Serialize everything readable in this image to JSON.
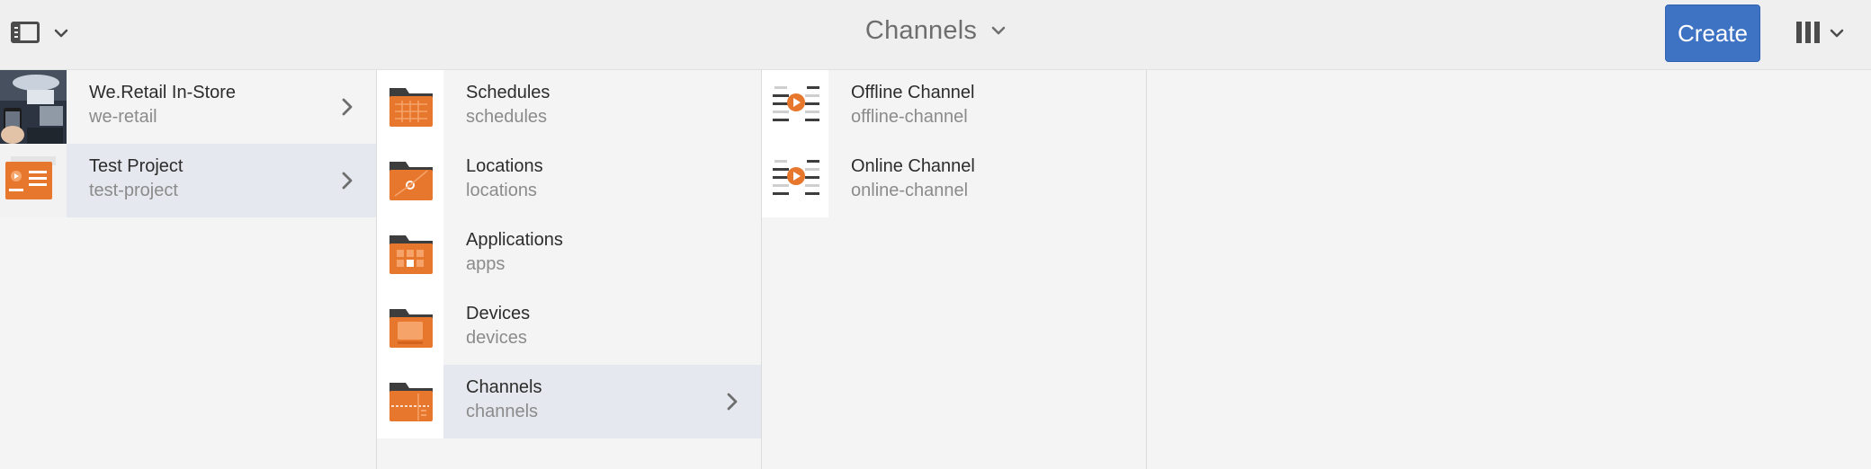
{
  "header": {
    "title": "Channels",
    "create_label": "Create",
    "rail_icon": "side-panel-icon",
    "view_icon": "column-view-icon"
  },
  "columns": [
    {
      "items": [
        {
          "title": "We.Retail In-Store",
          "subtitle": "we-retail",
          "thumb": "we-retail-photo",
          "has_children": true,
          "selected": false
        },
        {
          "title": "Test Project",
          "subtitle": "test-project",
          "thumb": "project-thumbnail",
          "has_children": true,
          "selected": true
        }
      ]
    },
    {
      "items": [
        {
          "title": "Schedules",
          "subtitle": "schedules",
          "thumb": "folder-schedules-icon",
          "has_children": false,
          "selected": false
        },
        {
          "title": "Locations",
          "subtitle": "locations",
          "thumb": "folder-locations-icon",
          "has_children": false,
          "selected": false
        },
        {
          "title": "Applications",
          "subtitle": "apps",
          "thumb": "folder-apps-icon",
          "has_children": false,
          "selected": false
        },
        {
          "title": "Devices",
          "subtitle": "devices",
          "thumb": "folder-devices-icon",
          "has_children": false,
          "selected": false
        },
        {
          "title": "Channels",
          "subtitle": "channels",
          "thumb": "folder-channels-icon",
          "has_children": true,
          "selected": true
        }
      ]
    },
    {
      "items": [
        {
          "title": "Offline Channel",
          "subtitle": "offline-channel",
          "thumb": "channel-icon",
          "has_children": false,
          "selected": false
        },
        {
          "title": "Online Channel",
          "subtitle": "online-channel",
          "thumb": "channel-icon",
          "has_children": false,
          "selected": false
        }
      ]
    }
  ],
  "colors": {
    "accent": "#3e73c4",
    "folder_orange": "#e8772e",
    "folder_tab": "#3d3d3d",
    "selected_row": "#e5e8ee"
  }
}
